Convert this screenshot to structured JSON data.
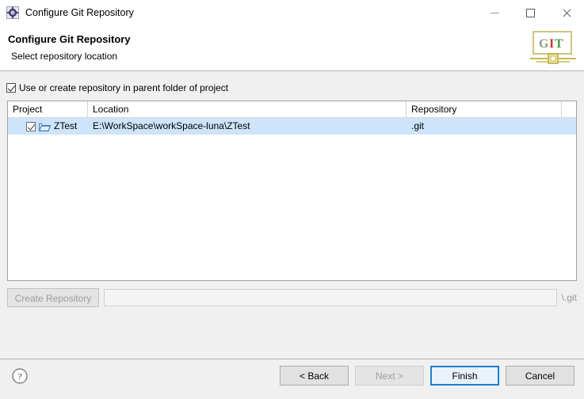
{
  "window": {
    "title": "Configure Git Repository",
    "icon": "git-config-icon",
    "controls": {
      "minimize": "minimize-icon",
      "maximize": "maximize-icon",
      "close": "close-icon"
    }
  },
  "header": {
    "title": "Configure Git Repository",
    "subtitle": "Select repository location",
    "logo_text": "GIT",
    "logo_letters": [
      "G",
      "I",
      "T"
    ],
    "logo_colors": [
      "#7f9a7f",
      "#c0392b",
      "#4d9a4d"
    ]
  },
  "options": {
    "parent_folder": {
      "label": "Use or create repository in parent folder of project",
      "checked": true
    }
  },
  "table": {
    "columns": [
      "Project",
      "Location",
      "Repository"
    ],
    "rows": [
      {
        "checked": true,
        "icon": "open-folder-icon",
        "project": "ZTest",
        "location": "E:\\WorkSpace\\workSpace-luna\\ZTest",
        "repository": ".git",
        "selected": true
      }
    ]
  },
  "create_repository": {
    "button_label": "Create Repository",
    "button_enabled": false,
    "path_value": "",
    "path_placeholder": "",
    "suffix_label": "\\.git"
  },
  "footer": {
    "help_icon": "help-icon",
    "buttons": [
      {
        "label": "< Back",
        "enabled": true,
        "default": false
      },
      {
        "label": "Next >",
        "enabled": false,
        "default": false
      },
      {
        "label": "Finish",
        "enabled": true,
        "default": true
      },
      {
        "label": "Cancel",
        "enabled": true,
        "default": false
      }
    ]
  },
  "colors": {
    "selection": "#cde4fb",
    "accent": "#1a7fd4",
    "panel": "#f0f0f0"
  }
}
